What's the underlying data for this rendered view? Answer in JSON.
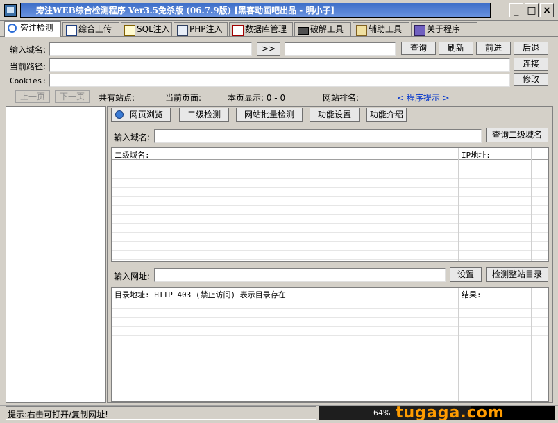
{
  "window": {
    "title": "旁注WEB综合检测程序 Ver3.5免杀版 (06.7.9版) [黑客动画吧出品 - 明小子]",
    "min_label": "_",
    "max_label": "□",
    "close_label": "×"
  },
  "tabs": [
    {
      "label": "旁注检测",
      "icon": "magnifier-icon"
    },
    {
      "label": "综合上传",
      "icon": "chart-icon"
    },
    {
      "label": "SQL注入",
      "icon": "magnifier-doc-icon"
    },
    {
      "label": "PHP注入",
      "icon": "php-doc-icon"
    },
    {
      "label": "数据库管理",
      "icon": "database-doc-icon"
    },
    {
      "label": "破解工具",
      "icon": "keyboard-icon"
    },
    {
      "label": "辅助工具",
      "icon": "clipboard-icon"
    },
    {
      "label": "关于程序",
      "icon": "books-icon"
    }
  ],
  "top": {
    "domain_label": "输入域名:",
    "domain_value": "",
    "go_label": ">>",
    "result_value": "",
    "query_label": "查询",
    "refresh_label": "刷新",
    "forward_label": "前进",
    "back_label": "后退",
    "path_label": "当前路径:",
    "path_value": "",
    "connect_label": "连接",
    "cookies_label": "Cookies:",
    "cookies_value": "",
    "modify_label": "修改"
  },
  "pager": {
    "prev_label": "上一页",
    "next_label": "下一页",
    "total_label": "共有站点:",
    "current_label": "当前页面:",
    "shown_label": "本页显示: 0 - 0",
    "rank_label": "网站排名:",
    "hint_link": "< 程序提示 >"
  },
  "subtabs": {
    "browse_label": "网页浏览",
    "second_label": "二级检测",
    "batch_label": "网站批量检测",
    "settings_label": "功能设置",
    "intro_label": "功能介绍"
  },
  "second_level": {
    "domain_label": "输入域名:",
    "domain_value": "",
    "query_label": "查询二级域名",
    "col_domain": "二级域名:",
    "col_ip": "IP地址:"
  },
  "dir_scan": {
    "url_label": "输入网址:",
    "url_value": "",
    "settings_label": "设置",
    "scan_label": "检测整站目录",
    "col_dir": "目录地址: HTTP 403 (禁止访问) 表示目录存在",
    "col_result": "结果:"
  },
  "statusbar": {
    "hint": "提示:右击可打开/复制网址!",
    "percent": "64%",
    "progress_fraction": 0.64,
    "watermark": "tugaga.com"
  }
}
